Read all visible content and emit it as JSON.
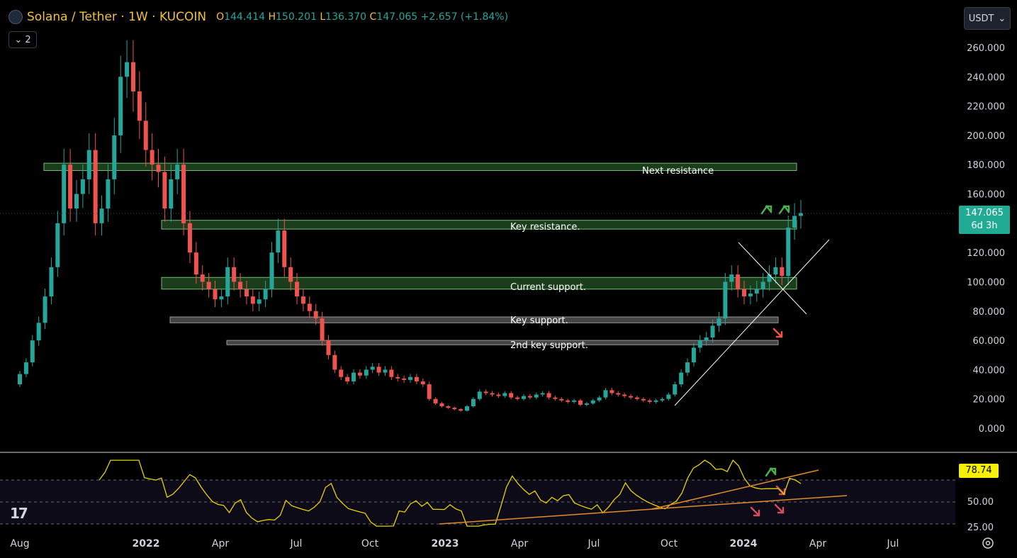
{
  "header": {
    "symbol": "Solana / Tether · 1W · KUCOIN",
    "open_label": "O",
    "open": "144.414",
    "high_label": "H",
    "high": "150.201",
    "low_label": "L",
    "low": "136.370",
    "close_label": "C",
    "close": "147.065",
    "change": "+2.657 (+1.84%)"
  },
  "controls": {
    "collapse_count": "2",
    "currency": "USDT"
  },
  "price_tag": {
    "price": "147.065",
    "countdown": "6d 3h"
  },
  "rsi_tag": "78.74",
  "logo": "17",
  "colors": {
    "up": "#26a69a",
    "down": "#ef5350",
    "rsi": "#e6d400",
    "trend": "#e08a2c"
  },
  "chart_data": {
    "type": "candlestick",
    "ylim": [
      0,
      260
    ],
    "y_ticks": [
      "260.000",
      "240.000",
      "220.000",
      "200.000",
      "180.000",
      "160.000",
      "120.000",
      "100.000",
      "80.000",
      "60.000",
      "40.000",
      "20.000",
      "0.000"
    ],
    "x_ticks": [
      "Aug",
      "2022",
      "Apr",
      "Jul",
      "Oct",
      "2023",
      "Apr",
      "Jul",
      "Oct",
      "2024",
      "Apr",
      "Jul"
    ],
    "rsi_ticks": [
      "50.00",
      "25.00"
    ],
    "annotations": [
      "Next resistance",
      "Key resistance.",
      "Current support.",
      "Key support.",
      "2nd key support."
    ],
    "zones": [
      {
        "label": "Next resistance",
        "low": 176,
        "high": 181,
        "color": "green"
      },
      {
        "label": "Key resistance.",
        "low": 136,
        "high": 142,
        "color": "green"
      },
      {
        "label": "Current support.",
        "low": 95,
        "high": 103,
        "color": "green"
      },
      {
        "label": "Key support.",
        "low": 72,
        "high": 76,
        "color": "gray"
      },
      {
        "label": "2nd key support.",
        "low": 57,
        "high": 60,
        "color": "gray"
      }
    ],
    "candles_close": [
      37,
      45,
      60,
      72,
      90,
      110,
      140,
      180,
      150,
      160,
      170,
      190,
      140,
      150,
      170,
      200,
      240,
      250,
      230,
      210,
      190,
      180,
      175,
      150,
      170,
      180,
      140,
      120,
      105,
      100,
      95,
      88,
      90,
      110,
      100,
      95,
      90,
      85,
      88,
      95,
      120,
      135,
      110,
      100,
      90,
      85,
      80,
      75,
      60,
      50,
      40,
      35,
      32,
      38,
      36,
      40,
      42,
      38,
      40,
      35,
      34,
      33,
      35,
      32,
      30,
      20,
      17,
      15,
      14,
      13,
      12,
      15,
      20,
      25,
      24,
      23,
      22,
      24,
      21,
      20,
      22,
      21,
      23,
      24,
      21,
      20,
      19,
      18,
      19,
      16,
      17,
      19,
      21,
      26,
      24,
      23,
      22,
      21,
      20,
      19,
      18,
      19,
      20,
      23,
      30,
      38,
      45,
      55,
      60,
      62,
      70,
      75,
      100,
      105,
      95,
      90,
      92,
      95,
      100,
      105,
      110,
      104,
      137,
      145,
      147
    ]
  }
}
